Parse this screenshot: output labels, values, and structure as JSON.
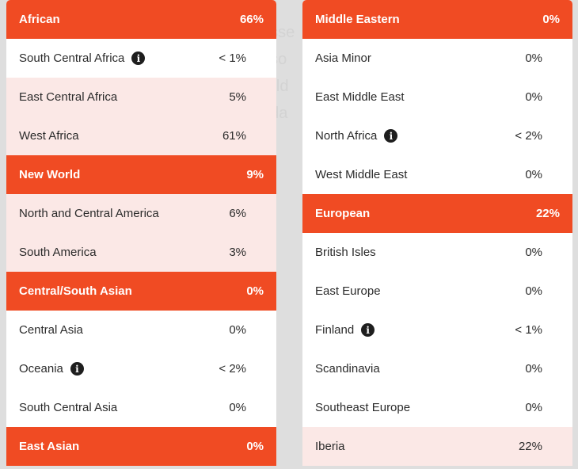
{
  "background_text": [
    "asse",
    "oso",
    "wild",
    "nda"
  ],
  "colors": {
    "header_bg": "#f04b23",
    "highlight_bg": "#fbe8e6",
    "page_bg": "#dedede"
  },
  "left_column": {
    "groups": [
      {
        "label": "African",
        "percent": "66%",
        "items": [
          {
            "label": "South Central Africa",
            "percent": "< 1%",
            "info": true,
            "highlight": false
          },
          {
            "label": "East Central Africa",
            "percent": "5%",
            "info": false,
            "highlight": true
          },
          {
            "label": "West Africa",
            "percent": "61%",
            "info": false,
            "highlight": true
          }
        ]
      },
      {
        "label": "New World",
        "percent": "9%",
        "items": [
          {
            "label": "North and Central America",
            "percent": "6%",
            "info": false,
            "highlight": true
          },
          {
            "label": "South America",
            "percent": "3%",
            "info": false,
            "highlight": true
          }
        ]
      },
      {
        "label": "Central/South Asian",
        "percent": "0%",
        "items": [
          {
            "label": "Central Asia",
            "percent": "0%",
            "info": false,
            "highlight": false
          },
          {
            "label": "Oceania",
            "percent": "< 2%",
            "info": true,
            "highlight": false
          },
          {
            "label": "South Central Asia",
            "percent": "0%",
            "info": false,
            "highlight": false
          }
        ]
      },
      {
        "label": "East Asian",
        "percent": "0%",
        "items": []
      }
    ]
  },
  "right_column": {
    "groups": [
      {
        "label": "Middle Eastern",
        "percent": "0%",
        "items": [
          {
            "label": "Asia Minor",
            "percent": "0%",
            "info": false,
            "highlight": false
          },
          {
            "label": "East Middle East",
            "percent": "0%",
            "info": false,
            "highlight": false
          },
          {
            "label": "North Africa",
            "percent": "< 2%",
            "info": true,
            "highlight": false
          },
          {
            "label": "West Middle East",
            "percent": "0%",
            "info": false,
            "highlight": false
          }
        ]
      },
      {
        "label": "European",
        "percent": "22%",
        "items": [
          {
            "label": "British Isles",
            "percent": "0%",
            "info": false,
            "highlight": false
          },
          {
            "label": "East Europe",
            "percent": "0%",
            "info": false,
            "highlight": false
          },
          {
            "label": "Finland",
            "percent": "< 1%",
            "info": true,
            "highlight": false
          },
          {
            "label": "Scandinavia",
            "percent": "0%",
            "info": false,
            "highlight": false
          },
          {
            "label": "Southeast Europe",
            "percent": "0%",
            "info": false,
            "highlight": false
          },
          {
            "label": "Iberia",
            "percent": "22%",
            "info": false,
            "highlight": true
          }
        ]
      }
    ]
  },
  "icons": {
    "info": "i"
  }
}
